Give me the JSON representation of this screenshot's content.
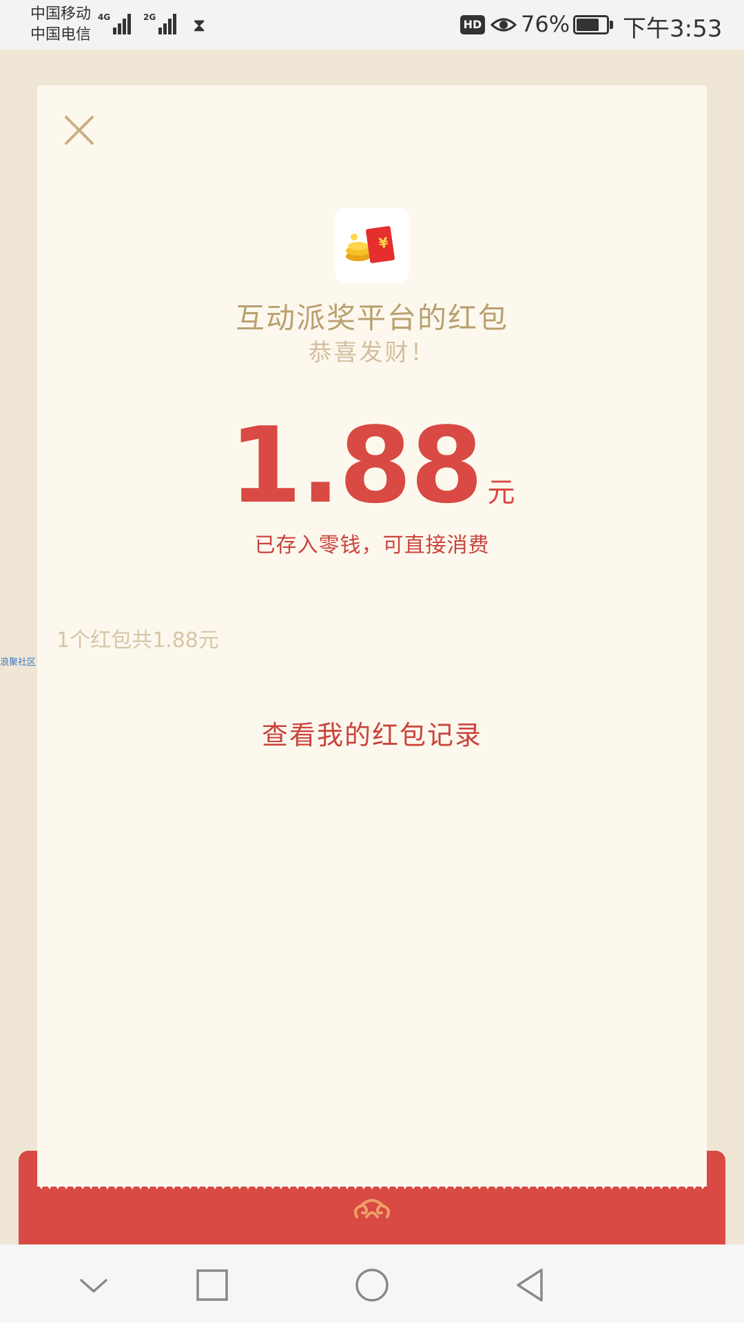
{
  "status_bar": {
    "carrier_1": "中国移动",
    "carrier_2": "中国电信",
    "network_1": "4G",
    "network_2": "2G",
    "hd_label": "HD",
    "battery_percent": "76%",
    "battery_level": 0.76,
    "time": "下午3:53"
  },
  "card": {
    "title": "互动派奖平台的红包",
    "subtitle": "恭喜发财！",
    "amount": "1.88",
    "currency": "元",
    "saved_note": "已存入零钱，可直接消费",
    "summary": "1个红包共1.88元",
    "records_link": "查看我的红包记录"
  },
  "watermark": "浪聚社区",
  "icons": {
    "close": "close-icon",
    "app": "red-packet-coins-icon",
    "envelope": "cloud-swirl-icon",
    "nav": [
      "chevron-down-icon",
      "square-icon",
      "circle-icon",
      "back-triangle-icon"
    ]
  },
  "colors": {
    "accent_red": "#d84a43",
    "card_bg": "#fdf8ee",
    "gold_text": "#b9a070",
    "page_bg": "#efe6d6"
  }
}
